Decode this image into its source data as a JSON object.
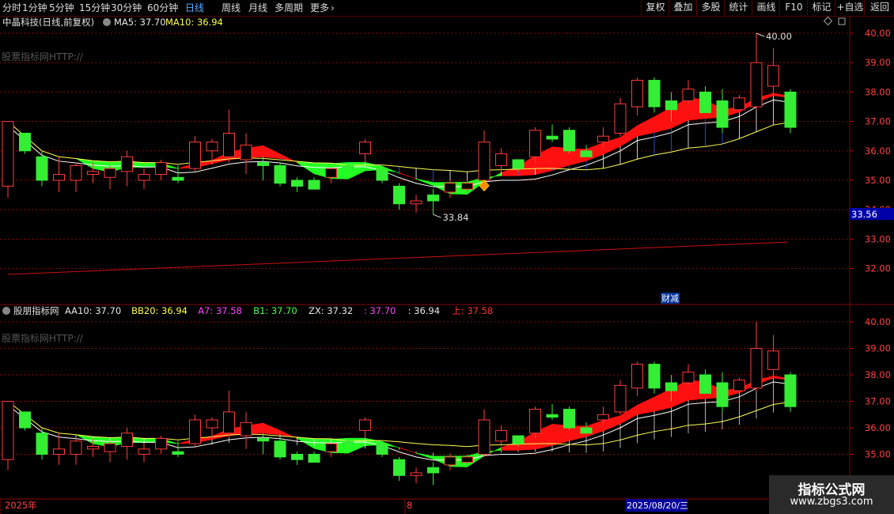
{
  "toolbar": {
    "periods": [
      "分时",
      "1分钟",
      "5分钟",
      "15分钟",
      "30分钟",
      "60分钟",
      "日线",
      "周线",
      "月线",
      "多周期",
      "更多"
    ],
    "active_period": "日线",
    "buttons": [
      "复权",
      "叠加",
      "多股",
      "统计",
      "画线",
      "F10",
      "标记",
      "+自选",
      "返回"
    ]
  },
  "main_panel": {
    "title": "中晶科技(日线,前复权)",
    "ma5_label": "MA5:",
    "ma5_value": "37.70",
    "ma10_label": "MA10:",
    "ma10_value": "36.94",
    "watermark": "股票指标网HTTP://",
    "high_label": "40.00",
    "low_label": "33.84",
    "price_tag": "33.56",
    "event_label": "财减",
    "yticks": [
      "40.00",
      "39.00",
      "38.00",
      "37.00",
      "36.00",
      "35.00",
      "34.00",
      "33.00",
      "32.00"
    ]
  },
  "sub_panel": {
    "title": "股朋指标网",
    "watermark": "股票指标网HTTP://",
    "legend": [
      {
        "label": "AA10:",
        "value": "37.70",
        "color": "#e8e8e8"
      },
      {
        "label": "BB20:",
        "value": "36.94",
        "color": "#ffff44"
      },
      {
        "label": "A7:",
        "value": "37.58",
        "color": "#ff44ff"
      },
      {
        "label": "B1:",
        "value": "37.70",
        "color": "#44ff44"
      },
      {
        "label": "ZX:",
        "value": "37.32",
        "color": "#e8e8e8"
      },
      {
        "label": ":",
        "value": "37.70",
        "color": "#ff44ff"
      },
      {
        "label": ":",
        "value": "36.94",
        "color": "#e8e8e8"
      },
      {
        "label": "上:",
        "value": "37.58",
        "color": "#ff3333"
      }
    ],
    "yticks": [
      "40.00",
      "39.00",
      "38.00",
      "37.00",
      "36.00",
      "35.00"
    ]
  },
  "xaxis": {
    "year_label": "2025年",
    "month_label": "8",
    "cursor_date": "2025/08/20/三"
  },
  "logo": {
    "line1": "指标公式网",
    "line2": "www.zbgs3.com"
  },
  "colors": {
    "up": "#ff3b3b",
    "down": "#33ee33",
    "ribbon_up": "#ff1010",
    "ribbon_down": "#22ff22",
    "grid": "#8b0000"
  },
  "chart_data": {
    "type": "candlestick",
    "ylim": [
      31.3,
      40.4
    ],
    "candles": [
      {
        "o": 34.8,
        "h": 36.9,
        "l": 34.4,
        "c": 37.0
      },
      {
        "o": 36.6,
        "h": 36.6,
        "l": 35.9,
        "c": 36.0
      },
      {
        "o": 35.8,
        "h": 36.0,
        "l": 34.8,
        "c": 35.0
      },
      {
        "o": 35.0,
        "h": 35.8,
        "l": 34.6,
        "c": 35.2
      },
      {
        "o": 35.0,
        "h": 35.6,
        "l": 34.6,
        "c": 35.5
      },
      {
        "o": 35.2,
        "h": 35.6,
        "l": 34.9,
        "c": 35.3
      },
      {
        "o": 35.1,
        "h": 35.5,
        "l": 34.7,
        "c": 35.4
      },
      {
        "o": 35.3,
        "h": 36.0,
        "l": 34.8,
        "c": 35.8
      },
      {
        "o": 35.0,
        "h": 35.4,
        "l": 34.7,
        "c": 35.2
      },
      {
        "o": 35.2,
        "h": 35.7,
        "l": 35.0,
        "c": 35.6
      },
      {
        "o": 35.1,
        "h": 35.5,
        "l": 34.9,
        "c": 35.0
      },
      {
        "o": 35.4,
        "h": 36.5,
        "l": 35.3,
        "c": 36.3
      },
      {
        "o": 36.0,
        "h": 36.4,
        "l": 35.6,
        "c": 36.3
      },
      {
        "o": 35.8,
        "h": 37.4,
        "l": 35.6,
        "c": 36.6
      },
      {
        "o": 35.7,
        "h": 36.6,
        "l": 35.2,
        "c": 36.2
      },
      {
        "o": 35.6,
        "h": 35.8,
        "l": 35.0,
        "c": 35.5
      },
      {
        "o": 35.5,
        "h": 35.6,
        "l": 34.8,
        "c": 34.9
      },
      {
        "o": 35.0,
        "h": 35.1,
        "l": 34.6,
        "c": 34.8
      },
      {
        "o": 35.0,
        "h": 35.1,
        "l": 34.7,
        "c": 34.7
      },
      {
        "o": 35.1,
        "h": 35.4,
        "l": 34.9,
        "c": 35.4
      },
      {
        "o": 35.5,
        "h": 35.6,
        "l": 35.1,
        "c": 35.4
      },
      {
        "o": 35.9,
        "h": 36.4,
        "l": 35.6,
        "c": 36.3
      },
      {
        "o": 35.4,
        "h": 35.5,
        "l": 34.9,
        "c": 35.0
      },
      {
        "o": 34.8,
        "h": 34.9,
        "l": 34.0,
        "c": 34.2
      },
      {
        "o": 34.2,
        "h": 34.5,
        "l": 33.9,
        "c": 34.3
      },
      {
        "o": 34.5,
        "h": 34.7,
        "l": 33.84,
        "c": 34.3
      },
      {
        "o": 34.6,
        "h": 35.0,
        "l": 34.4,
        "c": 34.9
      },
      {
        "o": 34.7,
        "h": 35.0,
        "l": 34.6,
        "c": 34.9
      },
      {
        "o": 35.0,
        "h": 36.7,
        "l": 34.9,
        "c": 36.3
      },
      {
        "o": 35.5,
        "h": 36.1,
        "l": 35.3,
        "c": 35.9
      },
      {
        "o": 35.7,
        "h": 35.7,
        "l": 35.3,
        "c": 35.4
      },
      {
        "o": 35.8,
        "h": 36.8,
        "l": 35.6,
        "c": 36.7
      },
      {
        "o": 36.5,
        "h": 36.9,
        "l": 36.3,
        "c": 36.4
      },
      {
        "o": 36.7,
        "h": 36.8,
        "l": 35.9,
        "c": 36.0
      },
      {
        "o": 36.0,
        "h": 36.2,
        "l": 35.8,
        "c": 35.8
      },
      {
        "o": 36.3,
        "h": 36.8,
        "l": 36.1,
        "c": 36.5
      },
      {
        "o": 36.6,
        "h": 37.8,
        "l": 36.5,
        "c": 37.6
      },
      {
        "o": 37.5,
        "h": 38.5,
        "l": 37.2,
        "c": 38.4
      },
      {
        "o": 38.4,
        "h": 38.5,
        "l": 37.3,
        "c": 37.5
      },
      {
        "o": 37.7,
        "h": 38.0,
        "l": 37.0,
        "c": 37.4
      },
      {
        "o": 37.7,
        "h": 38.4,
        "l": 37.6,
        "c": 38.1
      },
      {
        "o": 38.0,
        "h": 38.2,
        "l": 37.3,
        "c": 37.3
      },
      {
        "o": 37.7,
        "h": 38.1,
        "l": 36.6,
        "c": 36.8
      },
      {
        "o": 37.4,
        "h": 37.9,
        "l": 37.3,
        "c": 37.8
      },
      {
        "o": 37.5,
        "h": 40.0,
        "l": 37.4,
        "c": 39.0
      },
      {
        "o": 38.2,
        "h": 39.5,
        "l": 37.9,
        "c": 38.9
      },
      {
        "o": 38.0,
        "h": 38.1,
        "l": 36.6,
        "c": 36.8
      }
    ],
    "long_ma": {
      "from": 31.8,
      "to": 32.9
    }
  }
}
